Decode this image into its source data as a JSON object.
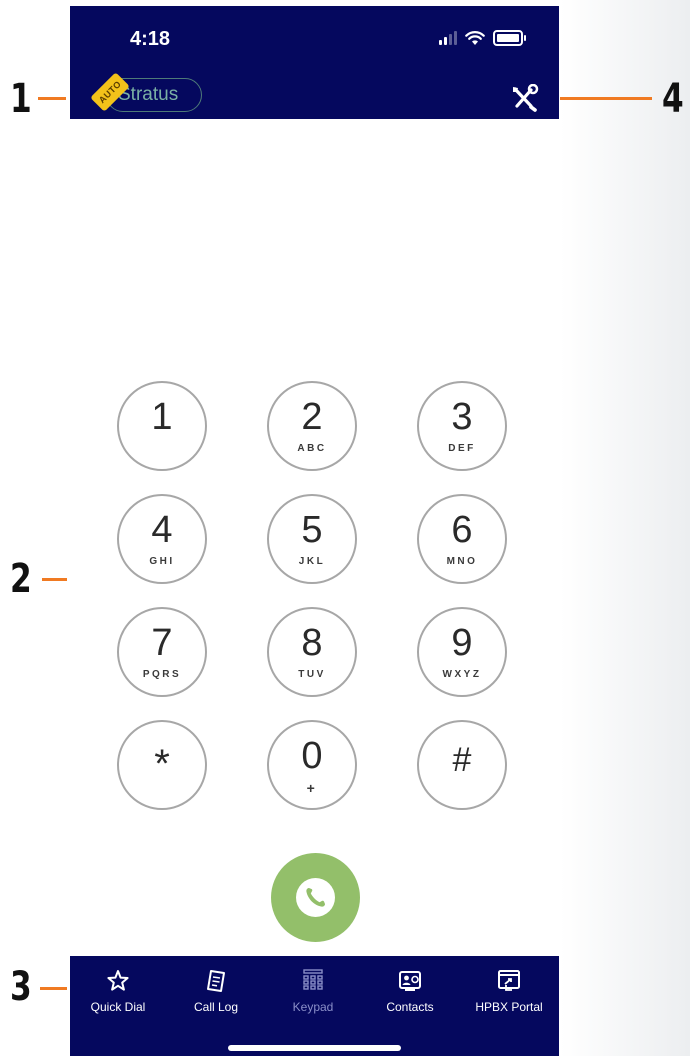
{
  "status_bar": {
    "time": "4:18"
  },
  "header": {
    "brand_label": "Stratus",
    "auto_tag": "AUTO",
    "tools_icon": "tools-icon"
  },
  "keypad": {
    "keys": [
      {
        "digit": "1",
        "letters": ""
      },
      {
        "digit": "2",
        "letters": "ABC"
      },
      {
        "digit": "3",
        "letters": "DEF"
      },
      {
        "digit": "4",
        "letters": "GHI"
      },
      {
        "digit": "5",
        "letters": "JKL"
      },
      {
        "digit": "6",
        "letters": "MNO"
      },
      {
        "digit": "7",
        "letters": "PQRS"
      },
      {
        "digit": "8",
        "letters": "TUV"
      },
      {
        "digit": "9",
        "letters": "WXYZ"
      },
      {
        "digit": "*",
        "letters": ""
      },
      {
        "digit": "0",
        "letters": "+"
      },
      {
        "digit": "#",
        "letters": ""
      }
    ]
  },
  "call_button": {
    "icon": "phone-icon",
    "color": "#93bf6a"
  },
  "tabbar": {
    "tabs": [
      {
        "label": "Quick Dial",
        "icon": "star-icon",
        "active": false
      },
      {
        "label": "Call Log",
        "icon": "call-log-icon",
        "active": false
      },
      {
        "label": "Keypad",
        "icon": "keypad-icon",
        "active": true
      },
      {
        "label": "Contacts",
        "icon": "contacts-icon",
        "active": false
      },
      {
        "label": "HPBX Portal",
        "icon": "portal-icon",
        "active": false
      }
    ]
  },
  "callouts": [
    "1",
    "2",
    "3",
    "4"
  ],
  "colors": {
    "nav_background": "#05085e",
    "accent_orange": "#f07a22",
    "brand_teal": "#7ab0a4",
    "tag_yellow": "#f3c21a"
  }
}
